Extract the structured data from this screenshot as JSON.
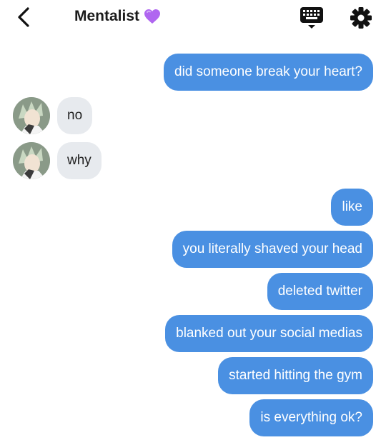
{
  "header": {
    "title": "Mentalist",
    "title_emoji": "purple-heart",
    "back_icon": "chevron-left-icon",
    "keyboard_icon": "keyboard-icon",
    "settings_icon": "gear-icon"
  },
  "messages": [
    {
      "side": "out",
      "text": "did someone break your heart?"
    },
    {
      "side": "in",
      "text": "no"
    },
    {
      "side": "in",
      "text": "why"
    },
    {
      "side": "out",
      "text": "like"
    },
    {
      "side": "out",
      "text": "you literally shaved your head"
    },
    {
      "side": "out",
      "text": "deleted twitter"
    },
    {
      "side": "out",
      "text": "blanked out your social medias"
    },
    {
      "side": "out",
      "text": "started hitting the gym"
    },
    {
      "side": "out",
      "text": "is everything ok?"
    }
  ],
  "colors": {
    "outgoing_bubble": "#4a90e2",
    "incoming_bubble": "#e7eaee",
    "heart": "#a855f7"
  }
}
